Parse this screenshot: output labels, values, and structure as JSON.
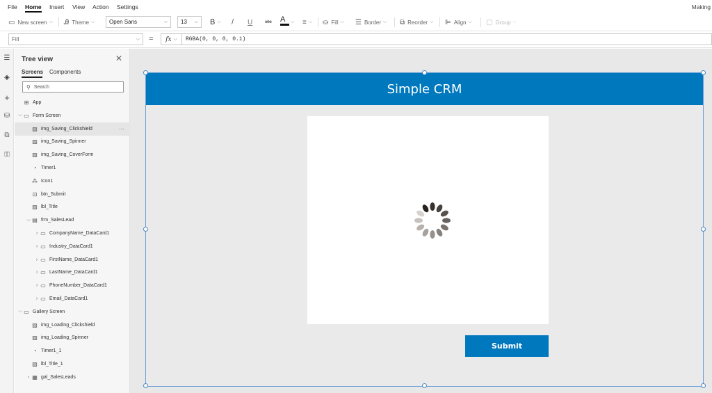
{
  "menubar": {
    "items": [
      "File",
      "Home",
      "Insert",
      "View",
      "Action",
      "Settings"
    ],
    "active": "Home",
    "right_text": "Making"
  },
  "toolbar": {
    "new_screen": "New screen",
    "theme": "Theme",
    "font": "Open Sans",
    "font_size": "13",
    "bold": "B",
    "italic": "/",
    "underline": "U",
    "strikethrough": "abc",
    "font_color": "A",
    "align_text": "≡",
    "fill": "Fill",
    "border": "Border",
    "reorder": "Reorder",
    "align": "Align",
    "group": "Group",
    "font_color_value": "#111111"
  },
  "formula_bar": {
    "property": "Fill",
    "equals": "=",
    "fx_label": "fx",
    "formula": "RGBA(0, 0, 0, 0.1)"
  },
  "tree": {
    "title": "Tree view",
    "tabs": [
      "Screens",
      "Components"
    ],
    "search_placeholder": "Search",
    "nodes": [
      {
        "label": "App",
        "icon": "app-icon",
        "indent": 0,
        "expander": ""
      },
      {
        "label": "Form Screen",
        "icon": "screen-icon",
        "indent": 0,
        "expander": "⌵"
      },
      {
        "label": "img_Saving_Clickshield",
        "icon": "image-icon",
        "indent": 1,
        "expander": "",
        "selected": true
      },
      {
        "label": "img_Saving_Spinner",
        "icon": "image-icon",
        "indent": 1,
        "expander": ""
      },
      {
        "label": "img_Saving_CoverForm",
        "icon": "image-icon",
        "indent": 1,
        "expander": ""
      },
      {
        "label": "Timer1",
        "icon": "timer-icon",
        "indent": 1,
        "expander": ""
      },
      {
        "label": "Icon1",
        "icon": "icon-control-icon",
        "indent": 1,
        "expander": ""
      },
      {
        "label": "btn_Submit",
        "icon": "button-icon",
        "indent": 1,
        "expander": ""
      },
      {
        "label": "lbl_Title",
        "icon": "label-icon",
        "indent": 1,
        "expander": ""
      },
      {
        "label": "frm_SalesLead",
        "icon": "form-icon",
        "indent": 1,
        "expander": "⌵"
      },
      {
        "label": "CompanyName_DataCard1",
        "icon": "datacard-icon",
        "indent": 2,
        "expander": "›"
      },
      {
        "label": "Industry_DataCard1",
        "icon": "datacard-icon",
        "indent": 2,
        "expander": "›"
      },
      {
        "label": "FirstName_DataCard1",
        "icon": "datacard-icon",
        "indent": 2,
        "expander": "›"
      },
      {
        "label": "LastName_DataCard1",
        "icon": "datacard-icon",
        "indent": 2,
        "expander": "›"
      },
      {
        "label": "PhoneNumber_DataCard1",
        "icon": "datacard-icon",
        "indent": 2,
        "expander": "›"
      },
      {
        "label": "Email_DataCard1",
        "icon": "datacard-icon",
        "indent": 2,
        "expander": "›"
      },
      {
        "label": "Gallery Screen",
        "icon": "screen-icon",
        "indent": 0,
        "expander": "⌵"
      },
      {
        "label": "img_Loading_Clickshield",
        "icon": "image-icon",
        "indent": 1,
        "expander": ""
      },
      {
        "label": "img_Loading_Spinner",
        "icon": "image-icon",
        "indent": 1,
        "expander": ""
      },
      {
        "label": "Timer1_1",
        "icon": "timer-icon",
        "indent": 1,
        "expander": ""
      },
      {
        "label": "lbl_Title_1",
        "icon": "label-icon",
        "indent": 1,
        "expander": ""
      },
      {
        "label": "gal_SalesLeads",
        "icon": "gallery-icon",
        "indent": 1,
        "expander": "›"
      }
    ]
  },
  "app_screen": {
    "header_title": "Simple CRM",
    "submit_label": "Submit",
    "header_color": "#0078be"
  }
}
